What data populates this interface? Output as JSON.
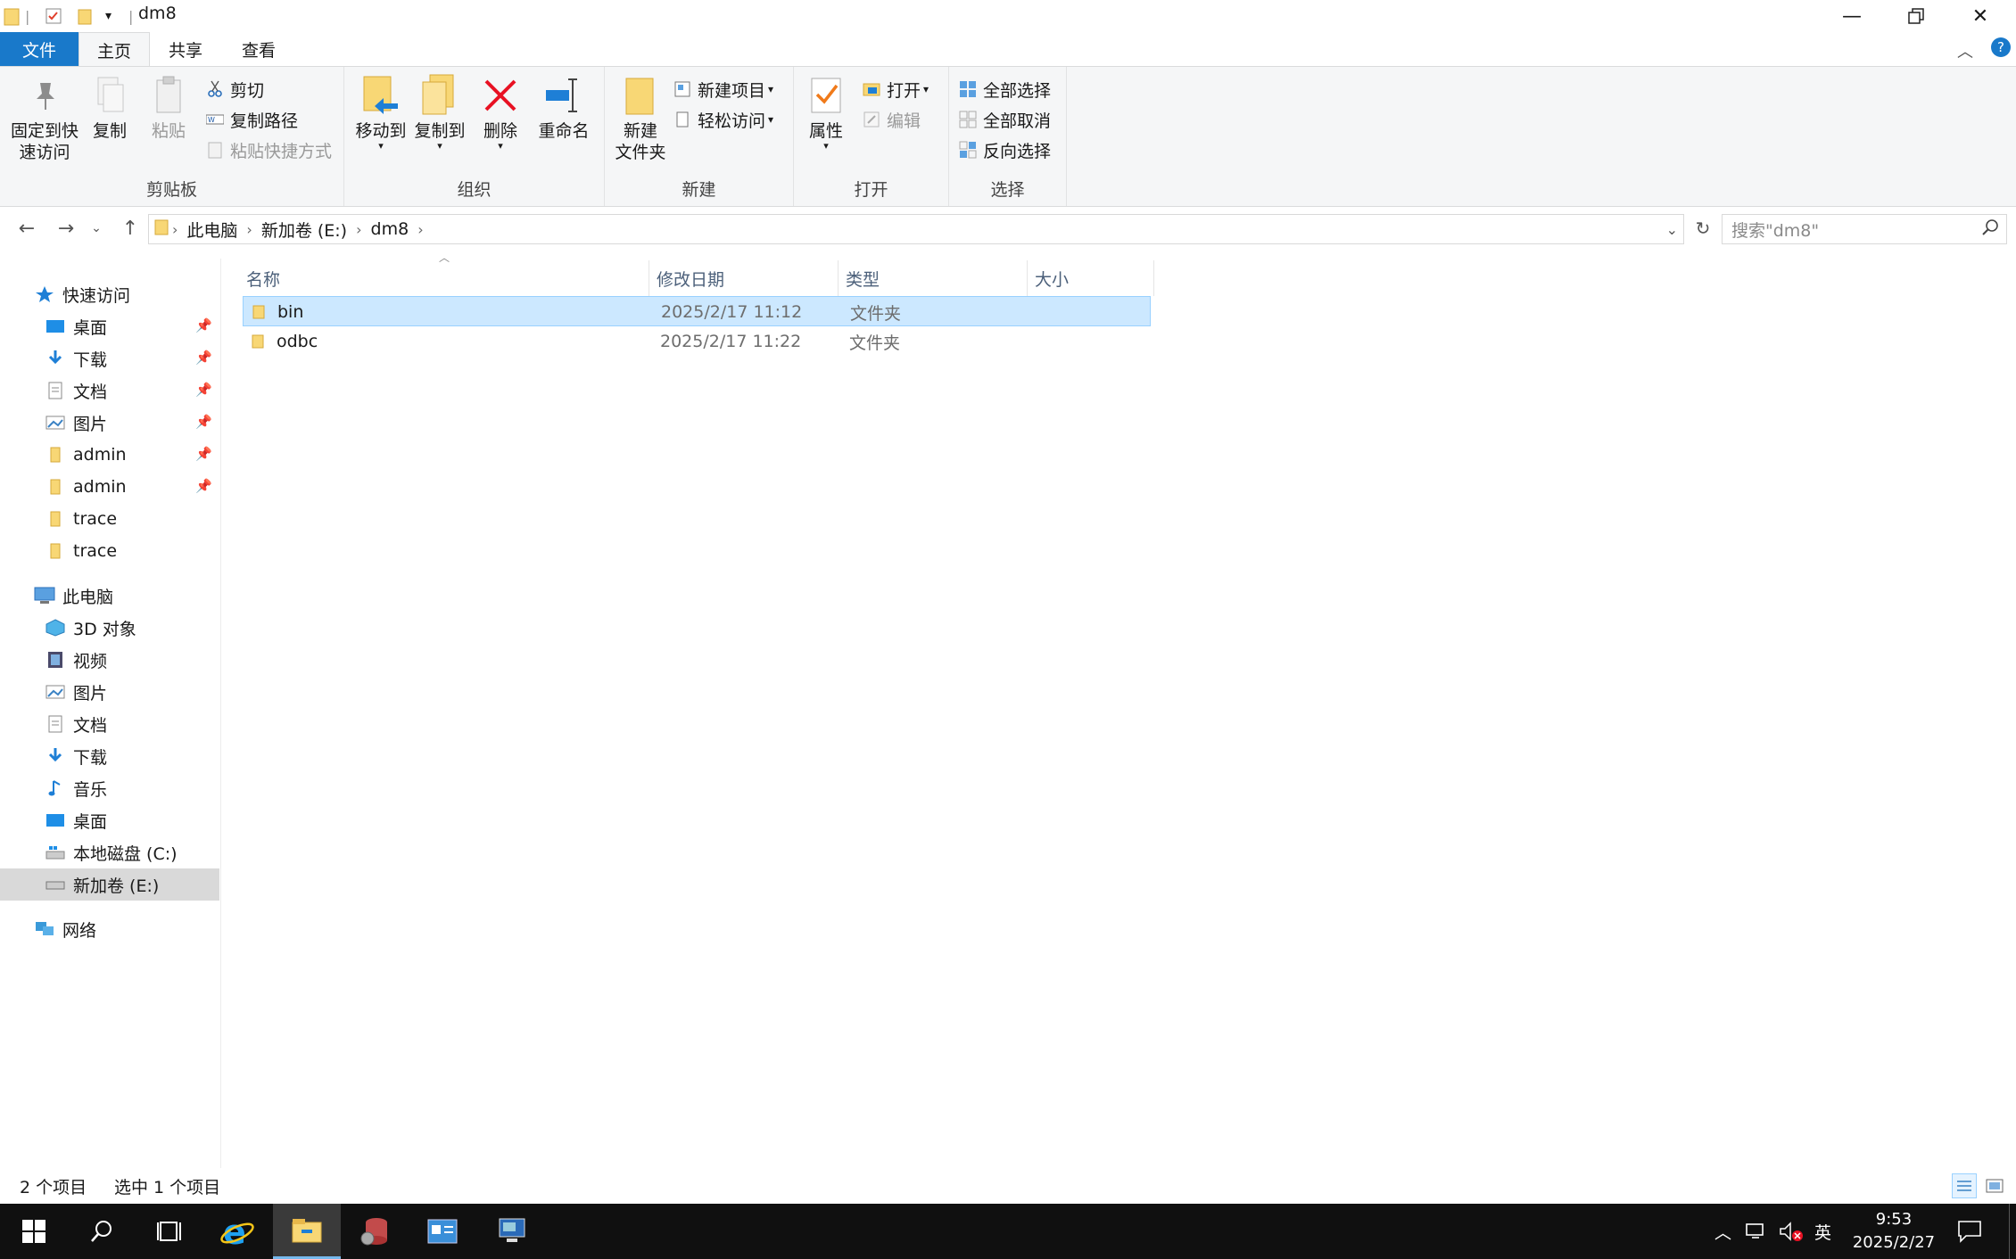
{
  "window": {
    "title": "dm8"
  },
  "tabs": {
    "file": "文件",
    "home": "主页",
    "share": "共享",
    "view": "查看"
  },
  "ribbon": {
    "clipboard": {
      "label": "剪贴板",
      "pin_label": "固定到快\n速访问",
      "copy": "复制",
      "paste": "粘贴",
      "cut": "剪切",
      "copy_path": "复制路径",
      "paste_shortcut": "粘贴快捷方式"
    },
    "organize": {
      "label": "组织",
      "move_to": "移动到",
      "copy_to": "复制到",
      "delete": "删除",
      "rename": "重命名"
    },
    "new": {
      "label": "新建",
      "new_folder": "新建\n文件夹",
      "new_item": "新建项目",
      "easy_access": "轻松访问"
    },
    "open": {
      "label": "打开",
      "properties": "属性",
      "open": "打开",
      "edit": "编辑"
    },
    "select": {
      "label": "选择",
      "select_all": "全部选择",
      "select_none": "全部取消",
      "invert": "反向选择"
    }
  },
  "address": {
    "crumbs": [
      "此电脑",
      "新加卷 (E:)",
      "dm8"
    ],
    "search_placeholder": "搜索\"dm8\""
  },
  "sidebar": {
    "quick_access": "快速访问",
    "quick_items": [
      "桌面",
      "下载",
      "文档",
      "图片",
      "admin",
      "admin",
      "trace",
      "trace"
    ],
    "this_pc": "此电脑",
    "pc_items": [
      "3D 对象",
      "视频",
      "图片",
      "文档",
      "下载",
      "音乐",
      "桌面",
      "本地磁盘 (C:)",
      "新加卷 (E:)"
    ],
    "network": "网络"
  },
  "columns": {
    "name": "名称",
    "modified": "修改日期",
    "type": "类型",
    "size": "大小"
  },
  "files": [
    {
      "name": "bin",
      "modified": "2025/2/17 11:12",
      "type": "文件夹",
      "size": ""
    },
    {
      "name": "odbc",
      "modified": "2025/2/17 11:22",
      "type": "文件夹",
      "size": ""
    }
  ],
  "status": {
    "count": "2 个项目",
    "selected": "选中 1 个项目"
  },
  "tray": {
    "ime": "英",
    "time": "9:53",
    "date": "2025/2/27"
  },
  "colors": {
    "accent": "#1979ca",
    "selection": "#cce8ff",
    "folder": "#f8d775"
  }
}
